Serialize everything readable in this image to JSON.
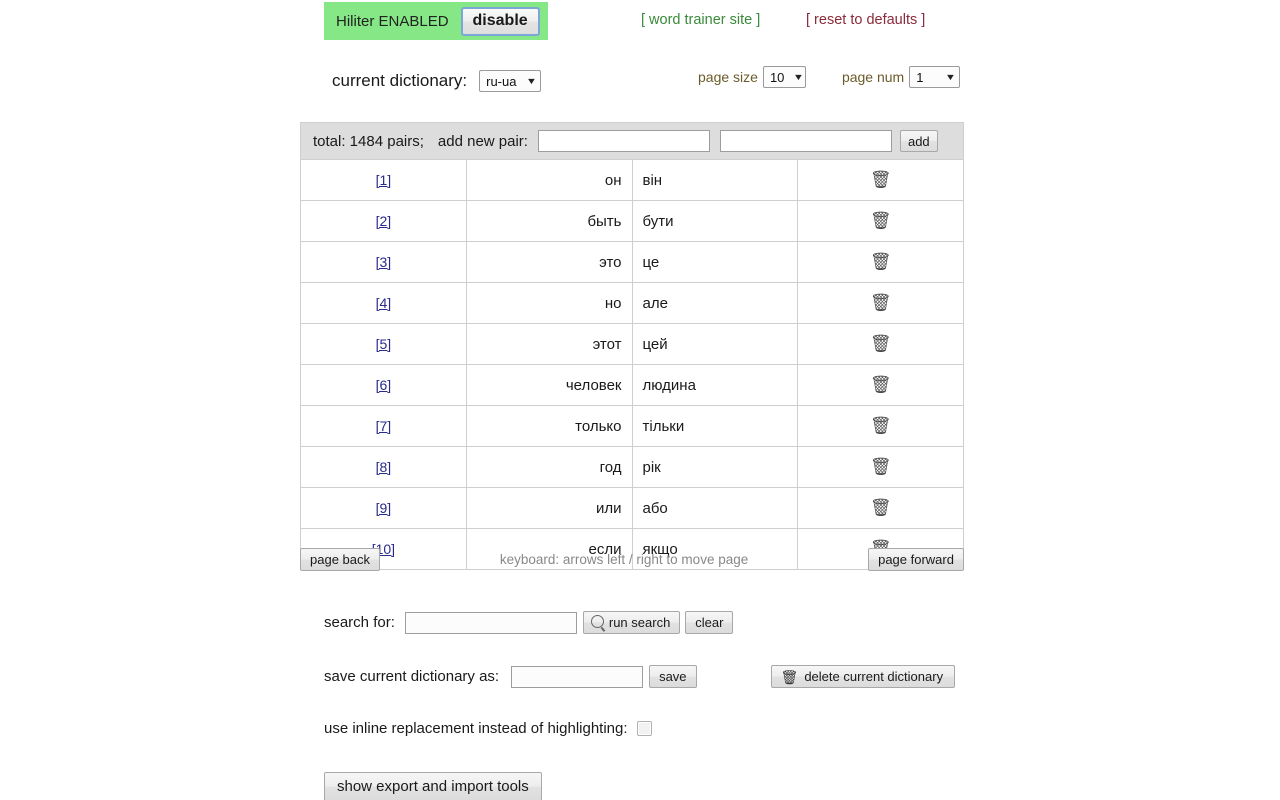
{
  "header": {
    "status_text": "Hiliter ENABLED",
    "toggle_label": "disable",
    "status_bg": "#85e785",
    "links": {
      "word_trainer": "[ word trainer site ]",
      "word_trainer_color": "#3a8a3a",
      "reset_defaults": "[ reset to defaults ]",
      "reset_defaults_color": "#8b2b3a"
    }
  },
  "dictionary": {
    "label": "current dictionary:",
    "selected": "ru-ua",
    "options": [
      "ru-ua"
    ]
  },
  "paging": {
    "page_size_label": "page size",
    "page_size_value": "10",
    "page_num_label": "page num",
    "page_num_value": "1",
    "back_label": "page back",
    "forward_label": "page forward",
    "keyboard_hint": "keyboard: arrows left / right to move page"
  },
  "table": {
    "total_text": "total: 1484 pairs;",
    "add_pair_label": "add new pair:",
    "add_source_value": "",
    "add_target_value": "",
    "add_button_label": "add",
    "delete_icon": "🗑",
    "rows": [
      {
        "index": "[1]",
        "source": "он",
        "target": "він"
      },
      {
        "index": "[2]",
        "source": "быть",
        "target": "бути"
      },
      {
        "index": "[3]",
        "source": "это",
        "target": "це"
      },
      {
        "index": "[4]",
        "source": "но",
        "target": "але"
      },
      {
        "index": "[5]",
        "source": "этот",
        "target": "цей"
      },
      {
        "index": "[6]",
        "source": "человек",
        "target": "людина"
      },
      {
        "index": "[7]",
        "source": "только",
        "target": "тільки"
      },
      {
        "index": "[8]",
        "source": "год",
        "target": "рік"
      },
      {
        "index": "[9]",
        "source": "или",
        "target": "або"
      },
      {
        "index": "[10]",
        "source": "если",
        "target": "якщо"
      }
    ]
  },
  "search": {
    "label": "search for:",
    "value": "",
    "run_label": "run search",
    "clear_label": "clear"
  },
  "save": {
    "label": "save current dictionary as:",
    "value": "",
    "save_label": "save",
    "delete_label": "delete current dictionary"
  },
  "inline_replacement": {
    "label": "use inline replacement instead of highlighting:",
    "checked": false
  },
  "export": {
    "label": "show export and import tools"
  }
}
